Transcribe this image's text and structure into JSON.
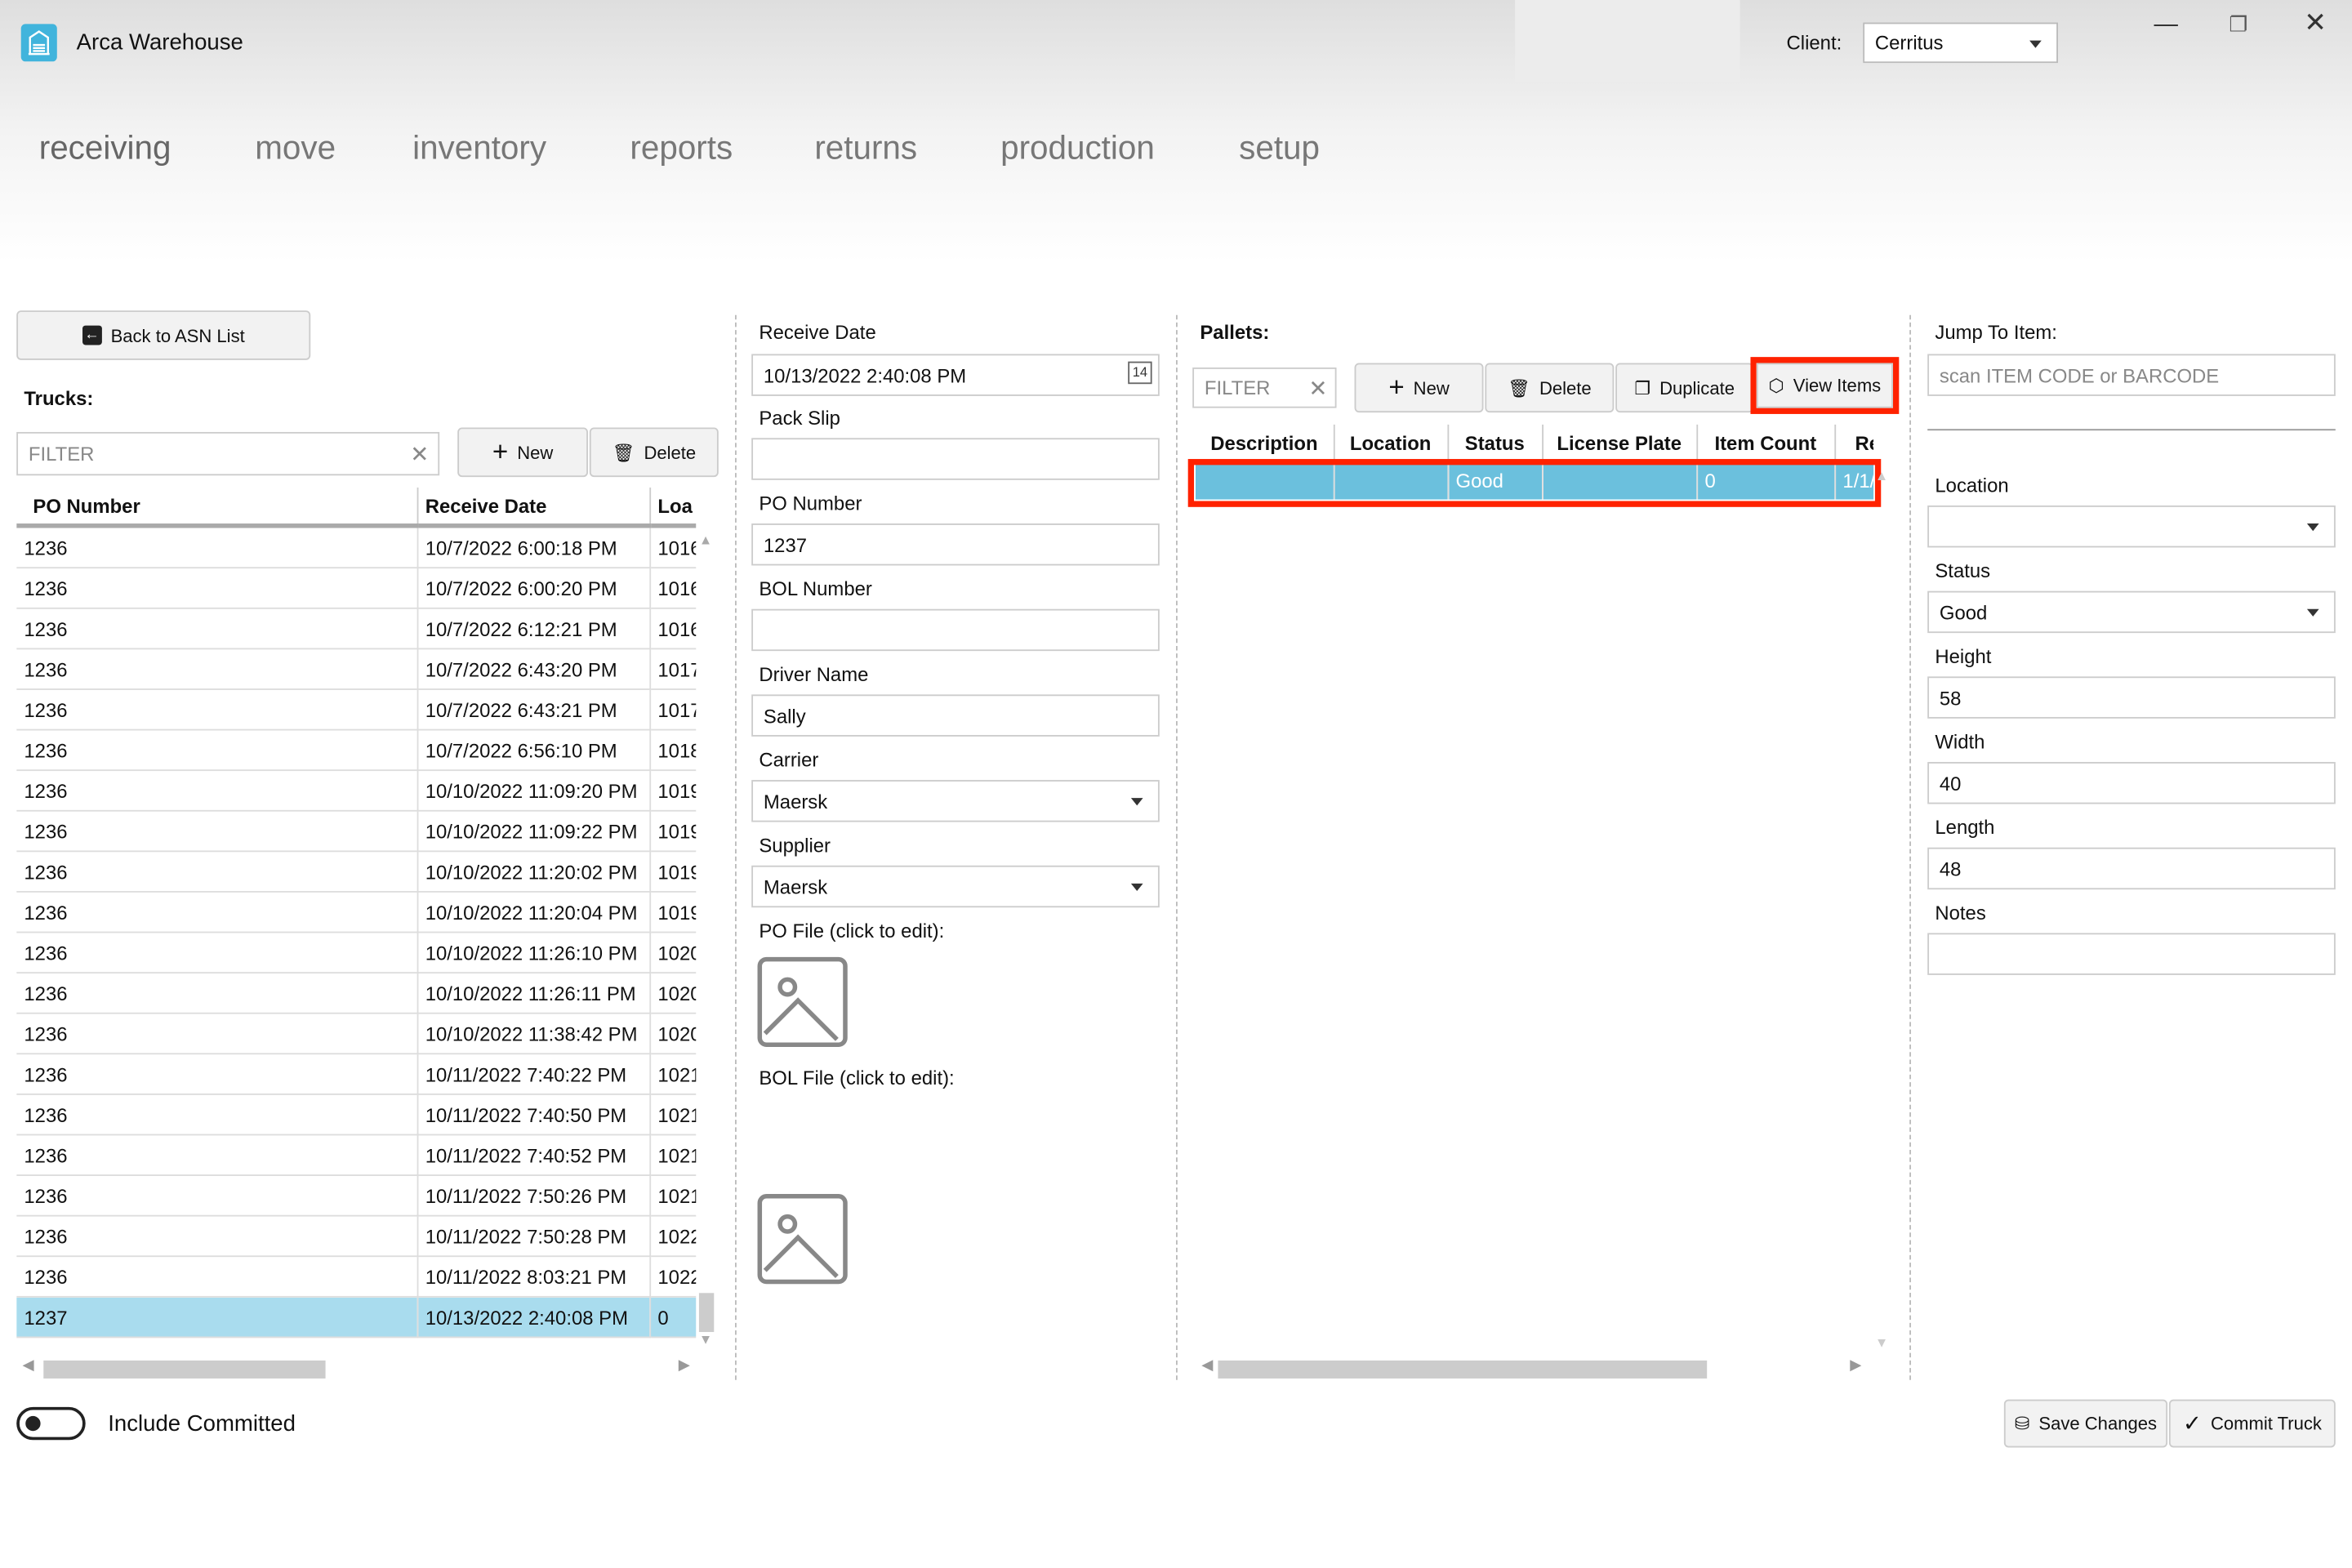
{
  "app": {
    "title": "Arca Warehouse",
    "client_label": "Client:",
    "client_value": "Cerritus"
  },
  "nav": [
    "receiving",
    "move",
    "inventory",
    "reports",
    "returns",
    "production",
    "setup"
  ],
  "left": {
    "back_label": "Back to ASN List",
    "trucks_label": "Trucks:",
    "filter_placeholder": "FILTER",
    "new_label": "New",
    "delete_label": "Delete",
    "columns": [
      "PO Number",
      "Receive Date",
      "Loa"
    ],
    "rows": [
      [
        "1236",
        "10/7/2022 6:00:18 PM",
        "1016"
      ],
      [
        "1236",
        "10/7/2022 6:00:20 PM",
        "1016"
      ],
      [
        "1236",
        "10/7/2022 6:12:21 PM",
        "1016"
      ],
      [
        "1236",
        "10/7/2022 6:43:20 PM",
        "1017"
      ],
      [
        "1236",
        "10/7/2022 6:43:21 PM",
        "1017"
      ],
      [
        "1236",
        "10/7/2022 6:56:10 PM",
        "1018"
      ],
      [
        "1236",
        "10/10/2022 11:09:20 PM",
        "1019"
      ],
      [
        "1236",
        "10/10/2022 11:09:22 PM",
        "1019"
      ],
      [
        "1236",
        "10/10/2022 11:20:02 PM",
        "1019"
      ],
      [
        "1236",
        "10/10/2022 11:20:04 PM",
        "1019"
      ],
      [
        "1236",
        "10/10/2022 11:26:10 PM",
        "1020"
      ],
      [
        "1236",
        "10/10/2022 11:26:11 PM",
        "1020"
      ],
      [
        "1236",
        "10/10/2022 11:38:42 PM",
        "1020"
      ],
      [
        "1236",
        "10/11/2022 7:40:22 PM",
        "1021"
      ],
      [
        "1236",
        "10/11/2022 7:40:50 PM",
        "1021"
      ],
      [
        "1236",
        "10/11/2022 7:40:52 PM",
        "1021"
      ],
      [
        "1236",
        "10/11/2022 7:50:26 PM",
        "1021"
      ],
      [
        "1236",
        "10/11/2022 7:50:28 PM",
        "1022"
      ],
      [
        "1236",
        "10/11/2022 8:03:21 PM",
        "1022"
      ],
      [
        "1237",
        "10/13/2022 2:40:08 PM",
        "0"
      ]
    ],
    "selected_row": 19,
    "include_committed_label": "Include Committed",
    "include_committed": false
  },
  "form": {
    "receive_date_label": "Receive Date",
    "receive_date": "10/13/2022 2:40:08 PM",
    "pack_slip_label": "Pack Slip",
    "pack_slip": "",
    "po_number_label": "PO Number",
    "po_number": "1237",
    "bol_number_label": "BOL Number",
    "bol_number": "",
    "driver_label": "Driver Name",
    "driver": "Sally",
    "carrier_label": "Carrier",
    "carrier": "Maersk",
    "supplier_label": "Supplier",
    "supplier": "Maersk",
    "po_file_label": "PO File (click to edit):",
    "bol_file_label": "BOL File (click to edit):"
  },
  "pallets": {
    "label": "Pallets:",
    "filter_placeholder": "FILTER",
    "new_label": "New",
    "delete_label": "Delete",
    "duplicate_label": "Duplicate",
    "view_items_label": "View Items",
    "columns": [
      "Description",
      "Location",
      "Status",
      "License Plate",
      "Item Count",
      "Re"
    ],
    "rows": [
      [
        "",
        "",
        "Good",
        "",
        "0",
        "1/1/"
      ]
    ],
    "highlight_color": "#ff2200"
  },
  "right": {
    "jump_label": "Jump To Item:",
    "jump_placeholder": "scan ITEM CODE or BARCODE",
    "location_label": "Location",
    "location": "",
    "status_label": "Status",
    "status": "Good",
    "height_label": "Height",
    "height": "58",
    "width_label": "Width",
    "width": "40",
    "length_label": "Length",
    "length": "48",
    "notes_label": "Notes",
    "notes": "",
    "save_label": "Save Changes",
    "commit_label": "Commit Truck"
  },
  "colors": {
    "accent": "#41b4dc",
    "selected_row": "#a9dcee",
    "pallet_selected": "#6bc0dd"
  }
}
